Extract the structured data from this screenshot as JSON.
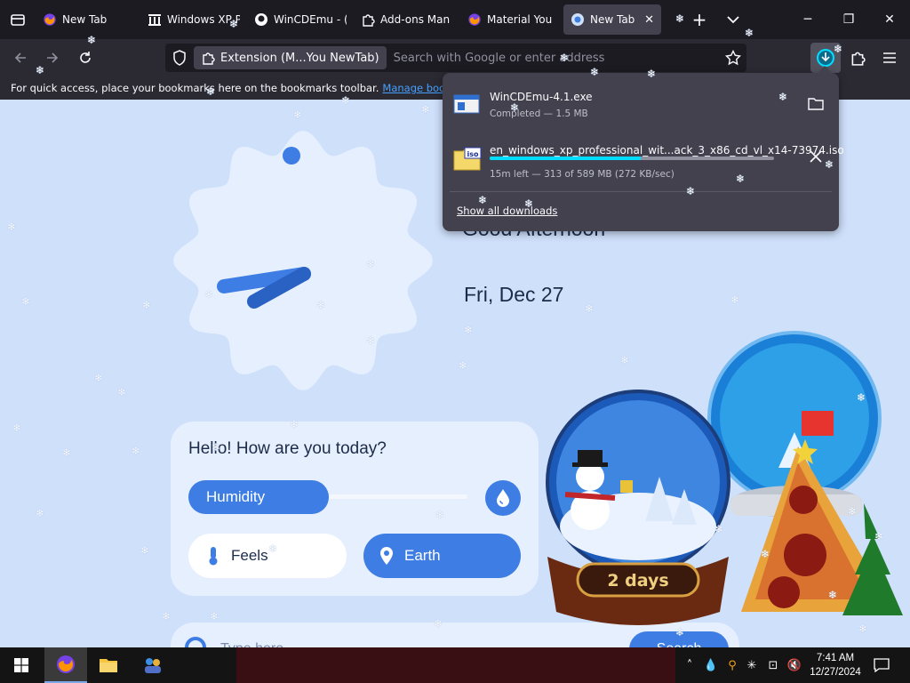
{
  "browser": {
    "tabs": [
      {
        "label": "New Tab",
        "icon": "firefox-icon",
        "active": false
      },
      {
        "label": "Windows XP P",
        "icon": "archive-columns-icon",
        "active": false
      },
      {
        "label": "WinCDEmu - (",
        "icon": "github-icon",
        "active": false
      },
      {
        "label": "Add-ons Man",
        "icon": "puzzle-icon",
        "active": false
      },
      {
        "label": "Material You N",
        "icon": "firefox-icon",
        "active": false
      },
      {
        "label": "New Tab",
        "icon": "material-newtab-icon",
        "active": true
      }
    ],
    "url_chip": "Extension (M...You NewTab)",
    "url_placeholder": "Search with Google or enter address",
    "bookmarks_text": "For quick access, place your bookmarks here on the bookmarks toolbar.",
    "bookmarks_link": "Manage bookmarks"
  },
  "downloads": {
    "items": [
      {
        "name": "WinCDEmu-4.1.exe",
        "status": "Completed — 1.5 MB",
        "icon": "exe-file-icon",
        "action": "folder-icon"
      },
      {
        "name": "en_windows_xp_professional_wit...ack_3_x86_cd_vl_x14-73974.iso",
        "status": "15m left — 313 of 589 MB (272 KB/sec)",
        "icon": "iso-file-icon",
        "action": "cancel-icon",
        "progress": 0.53
      }
    ],
    "show_all": "Show all downloads"
  },
  "page": {
    "time_partial": "Good Afternoon",
    "date": "Fri, Dec 27",
    "greeting": "Hello! How are you today?",
    "humidity_label": "Humidity",
    "humidity_level": 0.45,
    "feels_label": "Feels",
    "earth_label": "Earth",
    "search_placeholder": "Type here",
    "search_button": "Search",
    "globe_label": "2 days"
  },
  "taskbar": {
    "time": "7:41 AM",
    "date": "12/27/2024"
  },
  "colors": {
    "accent": "#3d7de4",
    "page_bg": "#cfe0fb",
    "card_bg": "#e6effd",
    "chrome_dark": "#1c1b22",
    "chrome": "#2b2a33",
    "progress": "#00ddff"
  }
}
